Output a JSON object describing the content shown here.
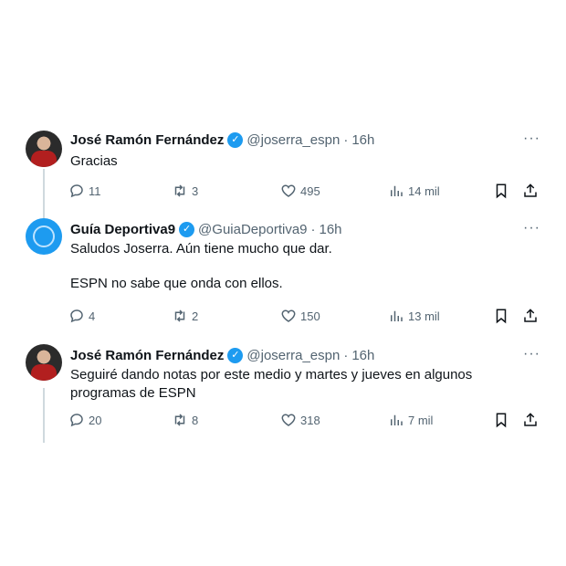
{
  "tweets": [
    {
      "name": "José Ramón Fernández",
      "handle": "@joserra_espn",
      "dot": "·",
      "time": "16h",
      "text_lines": [
        "Gracias"
      ],
      "replies": "11",
      "retweets": "3",
      "likes": "495",
      "views": "14 mil"
    },
    {
      "name": "Guía Deportiva9",
      "handle": "@GuiaDeportiva9",
      "dot": "·",
      "time": "16h",
      "text_lines": [
        "Saludos Joserra. Aún tiene mucho que dar.",
        "ESPN no sabe que onda con ellos."
      ],
      "replies": "4",
      "retweets": "2",
      "likes": "150",
      "views": "13 mil"
    },
    {
      "name": "José Ramón Fernández",
      "handle": "@joserra_espn",
      "dot": "·",
      "time": "16h",
      "text_lines": [
        "Seguiré dando notas por este medio y martes y jueves en algunos",
        "programas de ESPN"
      ],
      "replies": "20",
      "retweets": "8",
      "likes": "318",
      "views": "7 mil"
    }
  ],
  "icons": {
    "more": "more-icon",
    "reply": "reply-icon",
    "retweet": "retweet-icon",
    "like": "heart-icon",
    "views": "views-icon",
    "bookmark": "bookmark-icon",
    "share": "share-icon",
    "verified": "verified-icon"
  },
  "colors": {
    "accent": "#1d9bf0",
    "muted": "#536471",
    "text": "#0f1419"
  }
}
